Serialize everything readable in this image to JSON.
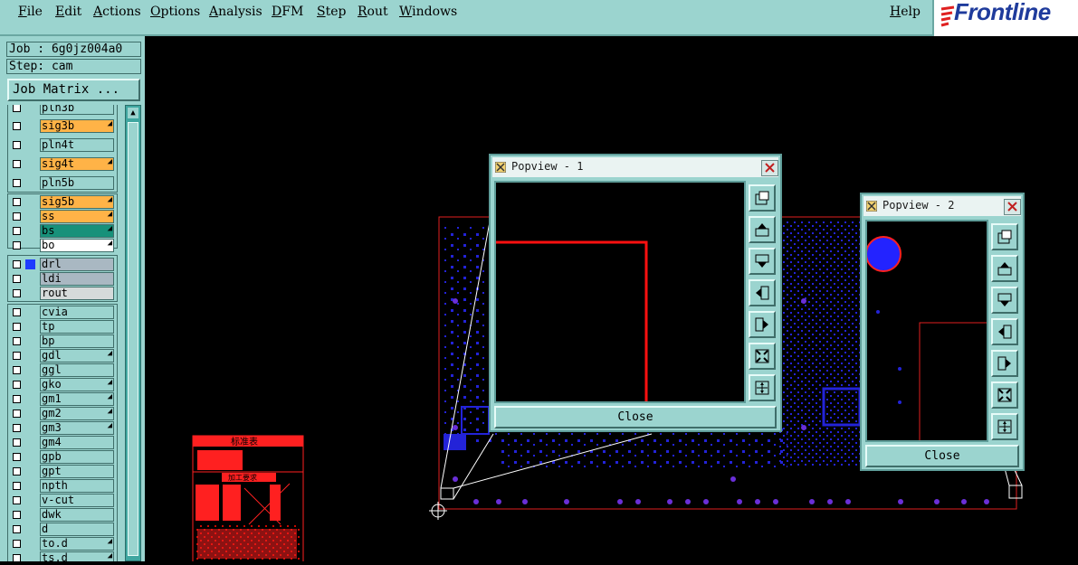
{
  "menu": {
    "items": [
      "File",
      "Edit",
      "Actions",
      "Options",
      "Analysis",
      "DFM",
      "Step",
      "Rout",
      "Windows"
    ],
    "help": "Help"
  },
  "brand": {
    "name": "Frontline",
    "color": "#1f3b9c"
  },
  "job": {
    "label": "Job : 6g0jz004a0",
    "step": "Step: cam",
    "matrix_button": "Job Matrix ..."
  },
  "layers": [
    {
      "name": "pln3b",
      "color": "#9bd4cf"
    },
    {
      "name": "sig3b",
      "color": "#ffb347",
      "arrow": true
    },
    {
      "name": "pln4t",
      "color": "#9bd4cf"
    },
    {
      "name": "sig4t",
      "color": "#ffb347",
      "arrow": true
    },
    {
      "name": "pln5b",
      "color": "#9bd4cf"
    },
    {
      "name": "sig5b",
      "color": "#ffb347",
      "arrow": true
    },
    {
      "name": "ss",
      "color": "#ffb347",
      "arrow": true
    },
    {
      "name": "bs",
      "color": "#17917a",
      "arrow": true
    },
    {
      "name": "bo",
      "color": "#ffffff",
      "arrow": true
    },
    {
      "name": "drl",
      "color": "#a9b8c2",
      "selected": true
    },
    {
      "name": "ldi",
      "color": "#a9b8c2"
    },
    {
      "name": "rout",
      "color": "#d5dada"
    },
    {
      "name": "cvia",
      "color": "#9bd4cf"
    },
    {
      "name": "tp",
      "color": "#9bd4cf"
    },
    {
      "name": "bp",
      "color": "#9bd4cf"
    },
    {
      "name": "gdl",
      "color": "#9bd4cf",
      "arrow": true
    },
    {
      "name": "ggl",
      "color": "#9bd4cf"
    },
    {
      "name": "gko",
      "color": "#9bd4cf",
      "arrow": true
    },
    {
      "name": "gm1",
      "color": "#9bd4cf",
      "arrow": true
    },
    {
      "name": "gm2",
      "color": "#9bd4cf",
      "arrow": true
    },
    {
      "name": "gm3",
      "color": "#9bd4cf",
      "arrow": true
    },
    {
      "name": "gm4",
      "color": "#9bd4cf"
    },
    {
      "name": "gpb",
      "color": "#9bd4cf"
    },
    {
      "name": "gpt",
      "color": "#9bd4cf"
    },
    {
      "name": "npth",
      "color": "#9bd4cf"
    },
    {
      "name": "v-cut",
      "color": "#9bd4cf"
    },
    {
      "name": "dwk",
      "color": "#9bd4cf"
    },
    {
      "name": "d",
      "color": "#9bd4cf"
    },
    {
      "name": "to.d",
      "color": "#9bd4cf",
      "arrow": true
    },
    {
      "name": "ts.d",
      "color": "#9bd4cf",
      "arrow": true
    }
  ],
  "popview1": {
    "title": "Popview - 1",
    "close_label": "Close"
  },
  "popview2": {
    "title": "Popview - 2",
    "close_label": "Close"
  },
  "stamp": {
    "title": "标准表",
    "subtitle": "加工要求"
  },
  "colors": {
    "panel": "#9bd4cf",
    "board_outline": "#e02020",
    "board_features": "#2323d8",
    "trace": "#ff1010"
  }
}
